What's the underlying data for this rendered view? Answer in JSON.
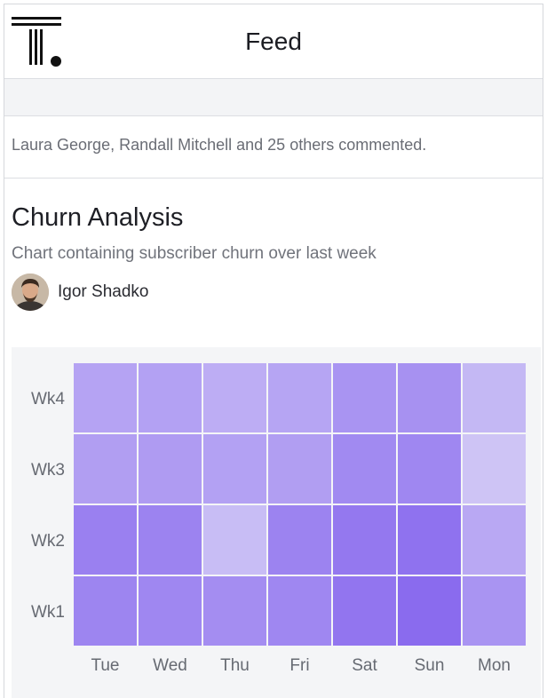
{
  "header": {
    "title": "Feed",
    "logo_icon": "t-logo-icon"
  },
  "activity": {
    "text": "Laura George, Randall Mitchell and 25 others commented."
  },
  "card": {
    "title": "Churn Analysis",
    "subtitle": "Chart containing subscriber churn over last week",
    "author": {
      "name": "Igor Shadko",
      "avatar_icon": "avatar"
    }
  },
  "colors": {
    "heat_low": "#d4ccf6",
    "heat_high": "#8666ee",
    "panel_bg": "#f4f5f7"
  },
  "chart_data": {
    "type": "heatmap",
    "x_categories": [
      "Tue",
      "Wed",
      "Thu",
      "Fri",
      "Sat",
      "Sun",
      "Mon"
    ],
    "y_categories": [
      "Wk4",
      "Wk3",
      "Wk2",
      "Wk1"
    ],
    "values": [
      [
        0.4,
        0.42,
        0.3,
        0.38,
        0.55,
        0.58,
        0.2
      ],
      [
        0.45,
        0.48,
        0.42,
        0.45,
        0.65,
        0.68,
        0.08
      ],
      [
        0.75,
        0.72,
        0.15,
        0.72,
        0.82,
        0.88,
        0.35
      ],
      [
        0.7,
        0.68,
        0.62,
        0.68,
        0.85,
        0.95,
        0.55
      ]
    ],
    "grid": false,
    "legend": "none"
  }
}
